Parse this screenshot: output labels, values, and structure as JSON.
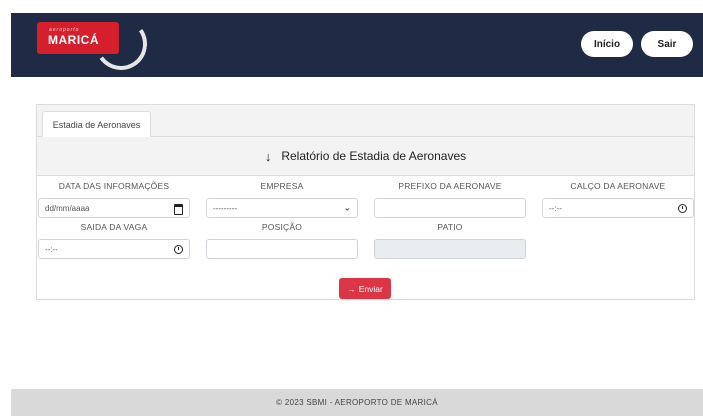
{
  "header": {
    "logo_small": "aeroporto",
    "logo_big": "MARICÁ",
    "inicio_label": "Início",
    "sair_label": "Sair"
  },
  "tabs": [
    {
      "label": "Estadia de Aeronaves"
    }
  ],
  "report": {
    "title": "Relatório de Estadia de Aeronaves"
  },
  "form": {
    "data_label": "DATA DAS INFORMAÇÕES",
    "data_placeholder": "dd/mm/aaaa",
    "empresa_label": "EMPRESA",
    "empresa_selected": "---------",
    "prefixo_label": "PREFIXO DA AERONAVE",
    "calco_label": "CALÇO DA AERONAVE",
    "calco_placeholder": "--:--",
    "saida_label": "SAIDA DA VAGA",
    "saida_placeholder": "--:--",
    "posicao_label": "POSIÇÃO",
    "patio_label": "PATIO"
  },
  "submit": {
    "arrow": "→",
    "label": "Enviar"
  },
  "footer": {
    "text": "© 2023 SBMI - AEROPORTO DE MARICÁ"
  },
  "colors": {
    "navbar": "#1f2a44",
    "brand_red": "#d51f2c",
    "button_red": "#dc3545"
  },
  "icons": {
    "header_arrow": "arrow-down-icon",
    "date": "calendar-icon",
    "time": "clock-icon",
    "select": "chevron-down-icon"
  }
}
